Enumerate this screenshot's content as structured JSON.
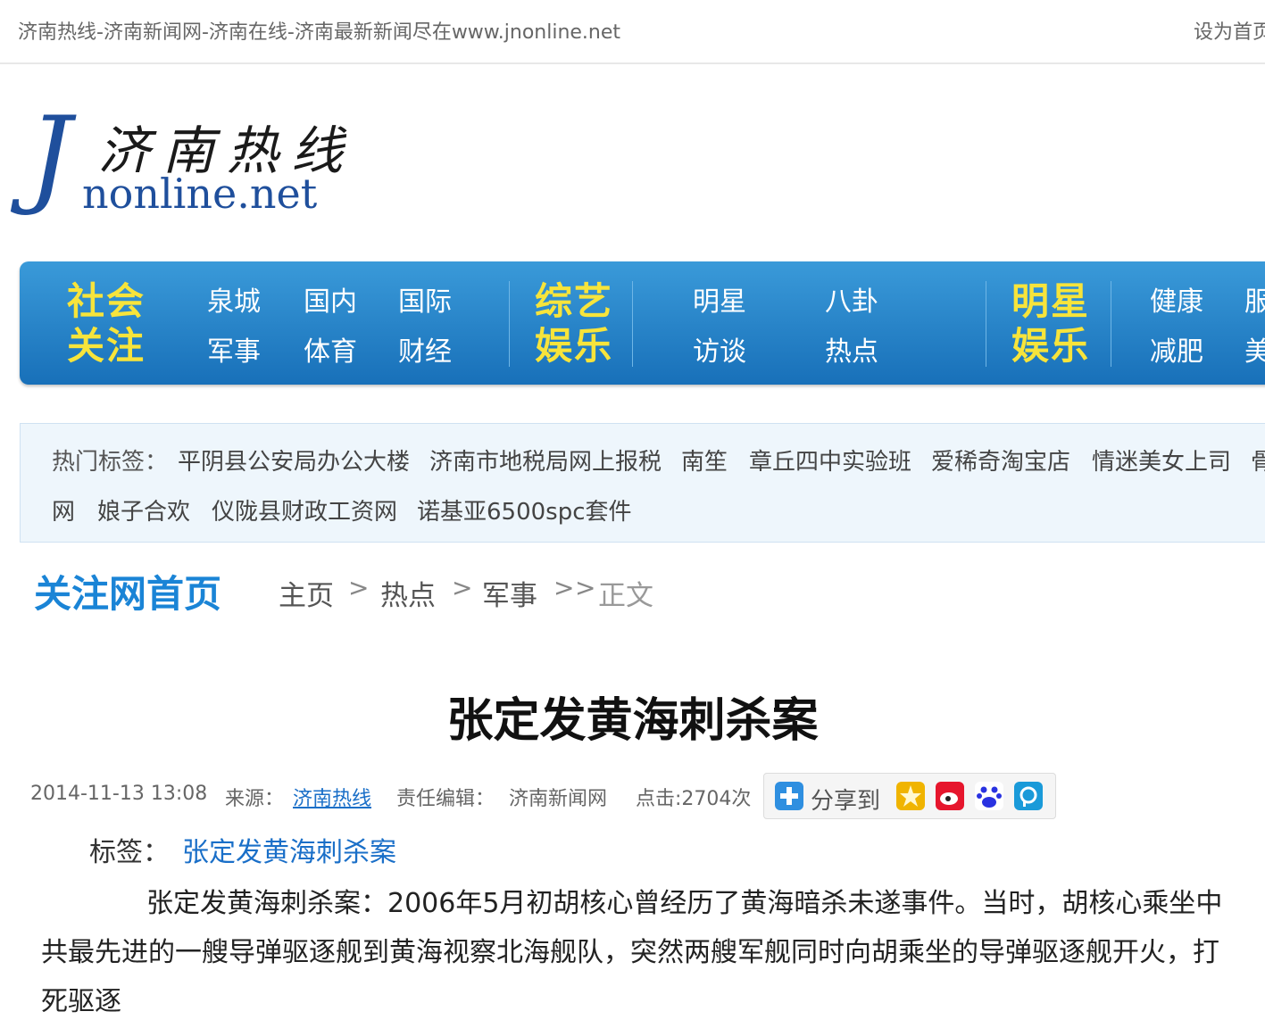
{
  "header": {
    "site_title": "济南热线-济南新闻网-济南在线-济南最新新闻尽在www.jnonline.net",
    "set_home": "设为首页"
  },
  "logo": {
    "letter": "J",
    "cn": "济南热线",
    "en": "nonline.net"
  },
  "nav": {
    "groups": [
      {
        "title": "社会关注",
        "links": [
          "泉城",
          "国内",
          "国际",
          "军事",
          "体育",
          "财经"
        ]
      },
      {
        "title": "综艺娱乐",
        "links": [
          "明星",
          "八卦",
          "访谈",
          "热点"
        ]
      },
      {
        "title": "明星娱乐",
        "links": [
          "健康",
          "服",
          "减肥",
          "美"
        ]
      }
    ]
  },
  "hot_tags": {
    "label": "热门标签：",
    "items": [
      "平阴县公安局办公大楼",
      "济南市地税局网上报税",
      "南笙",
      "章丘四中实验班",
      "爱稀奇淘宝店",
      "情迷美女上司",
      "骨",
      "网",
      "娘子合欢",
      "仪陇县财政工资网",
      "诺基亚6500spc套件"
    ]
  },
  "breadcrumb": {
    "brand": "关注网首页",
    "items": [
      "主页",
      "热点",
      "军事",
      "正文"
    ],
    "separator": ">"
  },
  "article": {
    "title": "张定发黄海刺杀案",
    "date": "2014-11-13 13:08",
    "source_label": "来源：",
    "source": "济南热线",
    "editor_label": "责任编辑：",
    "editor": "济南新闻网",
    "clicks": "点击:2704次",
    "share_label": "分享到",
    "tag_label": "标签：",
    "tag_value": "张定发黄海刺杀案",
    "body": "张定发黄海刺杀案：2006年5月初胡核心曾经历了黄海暗杀未遂事件。当时，胡核心乘坐中共最先进的一艘导弹驱逐舰到黄海视察北海舰队，突然两艘军舰同时向胡乘坐的导弹驱逐舰开火，打死驱逐"
  },
  "share_icons": [
    {
      "name": "qzone-icon",
      "color": "#f0b400"
    },
    {
      "name": "weibo-icon",
      "color": "#e6162d"
    },
    {
      "name": "baidu-icon",
      "color": "#2932e1"
    },
    {
      "name": "tqq-icon",
      "color": "#1a9ad9"
    }
  ]
}
